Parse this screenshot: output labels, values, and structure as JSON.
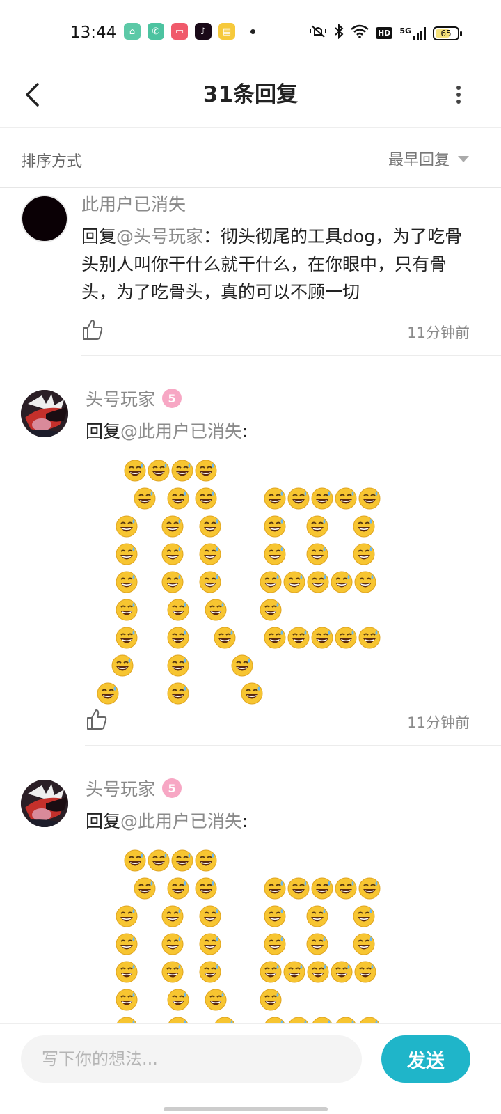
{
  "status_bar": {
    "time": "13:44",
    "network": "5G",
    "hd_label": "HD",
    "battery": "65",
    "battery_level": 0.65,
    "app_icons": [
      {
        "icon": "app-icon-green",
        "color": "#5cc9a7"
      },
      {
        "icon": "phone-icon",
        "color": "#4cc3a0"
      },
      {
        "icon": "video-icon",
        "color": "#f05a6b"
      },
      {
        "icon": "tiktok-icon",
        "color": "#1a0a18"
      },
      {
        "icon": "notes-icon",
        "color": "#f6c93b"
      }
    ]
  },
  "header": {
    "title": "31条回复"
  },
  "sort": {
    "label": "排序方式",
    "selected": "最早回复"
  },
  "comments": [
    {
      "username": "此用户已消失",
      "reply_prefix": "回复",
      "mention": "@头号玩家",
      "separator": "：",
      "text": "彻头彻尾的工具dog，为了吃骨头别人叫你干什么就干什么，在你眼中，只有骨头，为了吃骨头，真的可以不顾一切",
      "time": "11分钟前"
    },
    {
      "username": "头号玩家",
      "level_badge": "5",
      "reply_prefix": "回复",
      "mention": "@此用户已消失",
      "separator": ":",
      "emoji_art": "sweat-smile-emoji-art",
      "time": "11分钟前"
    },
    {
      "username": "头号玩家",
      "level_badge": "5",
      "reply_prefix": "回复",
      "mention": "@此用户已消失",
      "separator": ":",
      "emoji_art": "sweat-smile-emoji-art"
    }
  ],
  "input": {
    "placeholder": "写下你的想法...",
    "send_label": "发送"
  },
  "colors": {
    "accent": "#1fb5c9",
    "muted_text": "#8a8a8a",
    "badge_pink": "#f7a7c4",
    "emoji_yellow": "#f7c531"
  }
}
